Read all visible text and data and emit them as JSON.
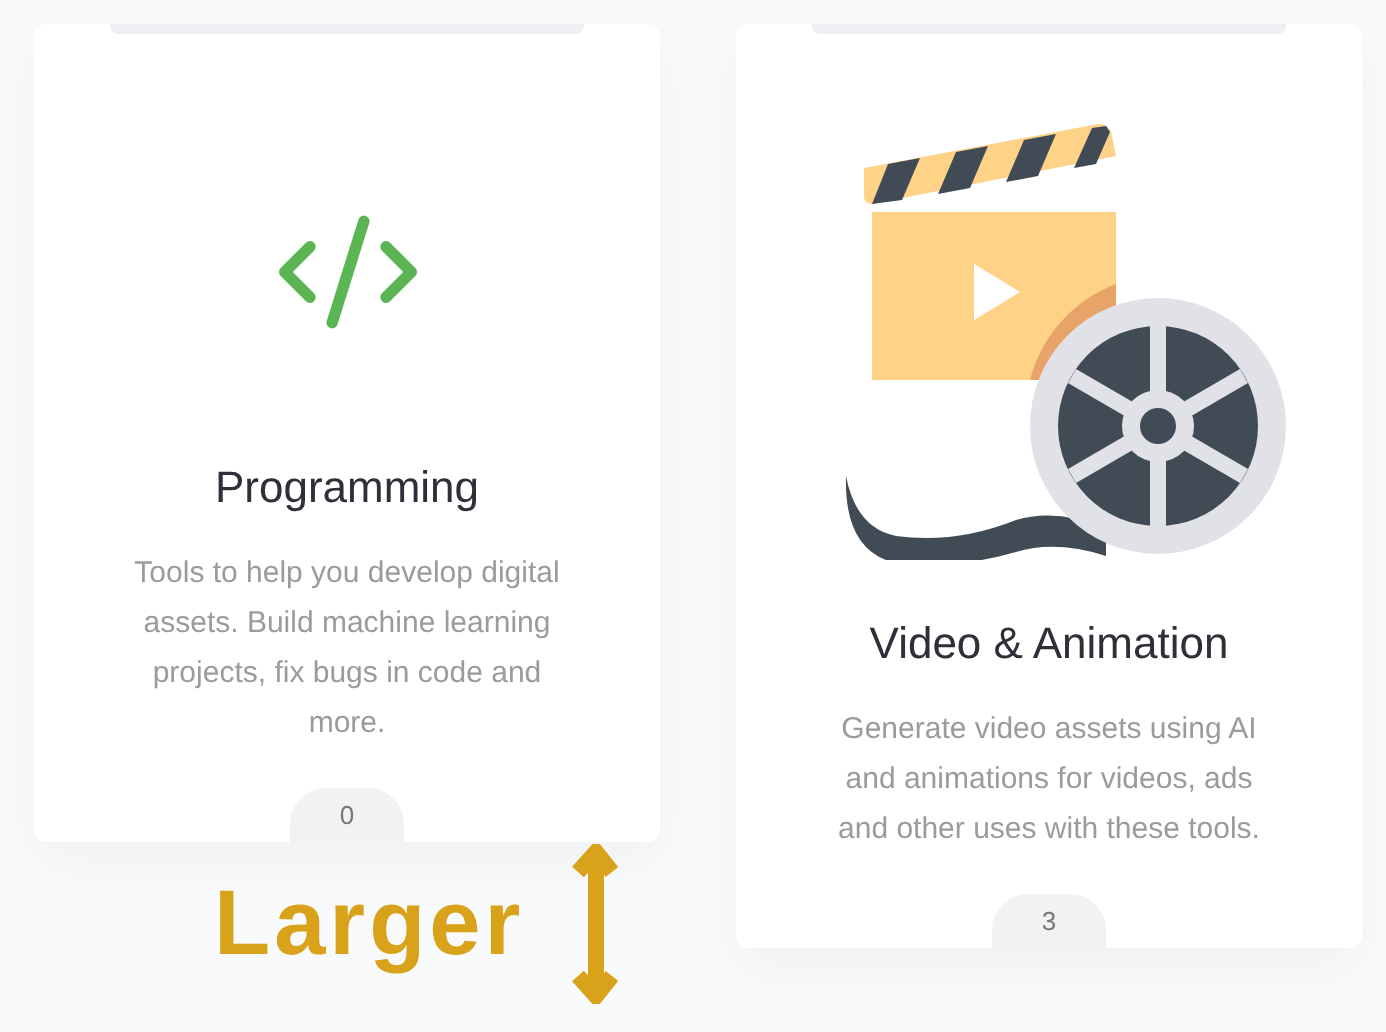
{
  "cards": [
    {
      "kind": "code",
      "title": "Programming",
      "description": "Tools to help you develop digital assets. Build machine learning projects, fix bugs in code and more.",
      "count": "0"
    },
    {
      "kind": "video",
      "title": "Video & Animation",
      "description": "Generate video assets using AI and animations for videos, ads and other uses with these tools.",
      "count": "3"
    }
  ],
  "annotation": {
    "text": "Larger"
  }
}
